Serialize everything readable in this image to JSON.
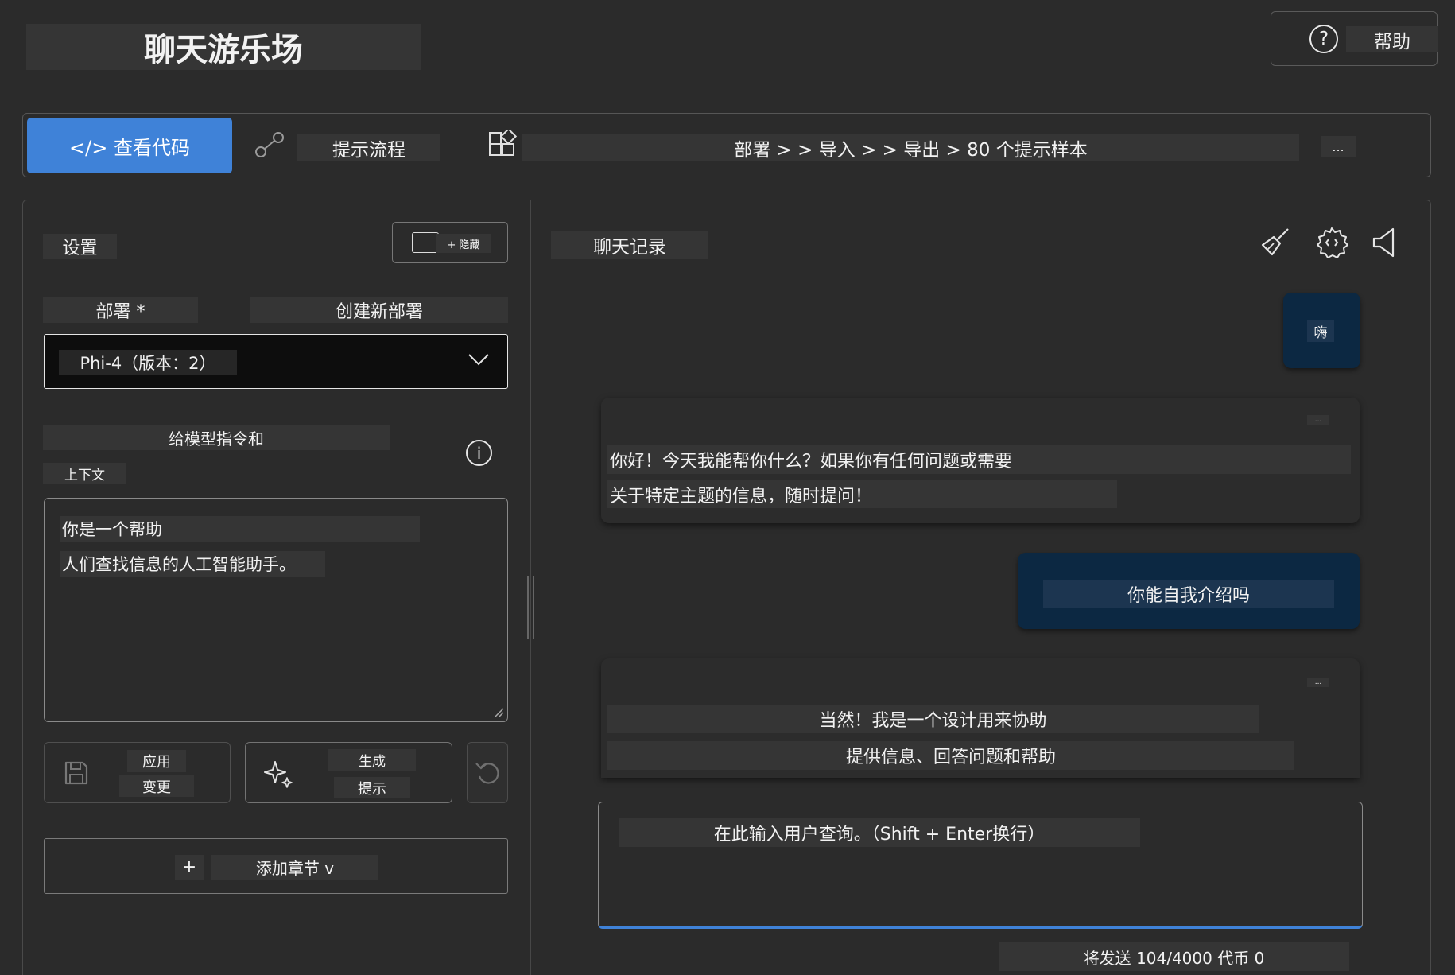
{
  "app": {
    "title": "聊天游乐场"
  },
  "header": {
    "help_label": "帮助",
    "help_icon_glyph": "?"
  },
  "toolbar": {
    "view_code_label": "</> 查看代码",
    "prompt_flow_label": "提示流程",
    "deploy_path": "部署 > > 导入 > > 导出 > 80 个提示样本",
    "more_label": "..."
  },
  "settings": {
    "title": "设置",
    "hide_label": "+ 隐藏",
    "deploy_label": "部署 *",
    "create_deploy_label": "创建新部署",
    "selected_model": "Phi-4（版本：2）",
    "instructions_label": "给模型指令和",
    "context_label": "上下文",
    "info_glyph": "i",
    "system_message_lines": [
      "你是一个帮助",
      "人们查找信息的人工智能助手。"
    ],
    "apply_label_1": "应用",
    "apply_label_2": "变更",
    "generate_label_1": "生成",
    "generate_label_2": "提示",
    "add_plus": "+",
    "add_section_label": "添加章节 v"
  },
  "chat": {
    "title": "聊天记录",
    "messages": [
      {
        "role": "user",
        "text": "嗨"
      },
      {
        "role": "assistant",
        "more": "...",
        "lines": [
          "你好！今天我能帮你什么？如果你有任何问题或需要",
          "关于特定主题的信息，随时提问！"
        ]
      },
      {
        "role": "user",
        "text": "你能自我介绍吗"
      },
      {
        "role": "assistant",
        "more": "...",
        "lines": [
          "当然！我是一个设计用来协助",
          "提供信息、回答问题和帮助"
        ]
      }
    ],
    "query_placeholder": "在此输入用户查询。（Shift + Enter换行）",
    "token_info": "将发送 104/4000 代币 0"
  },
  "colors": {
    "background": "#2b2b2b",
    "accent": "#3f82d8",
    "user_bubble": "#0c2842",
    "label_chip": "#353535"
  },
  "icons": [
    "help-icon",
    "flow-icon",
    "grid-icon",
    "chevron-down-icon",
    "info-icon",
    "save-icon",
    "sparkle-icon",
    "undo-icon",
    "broom-icon",
    "gear-icon",
    "speaker-icon"
  ]
}
